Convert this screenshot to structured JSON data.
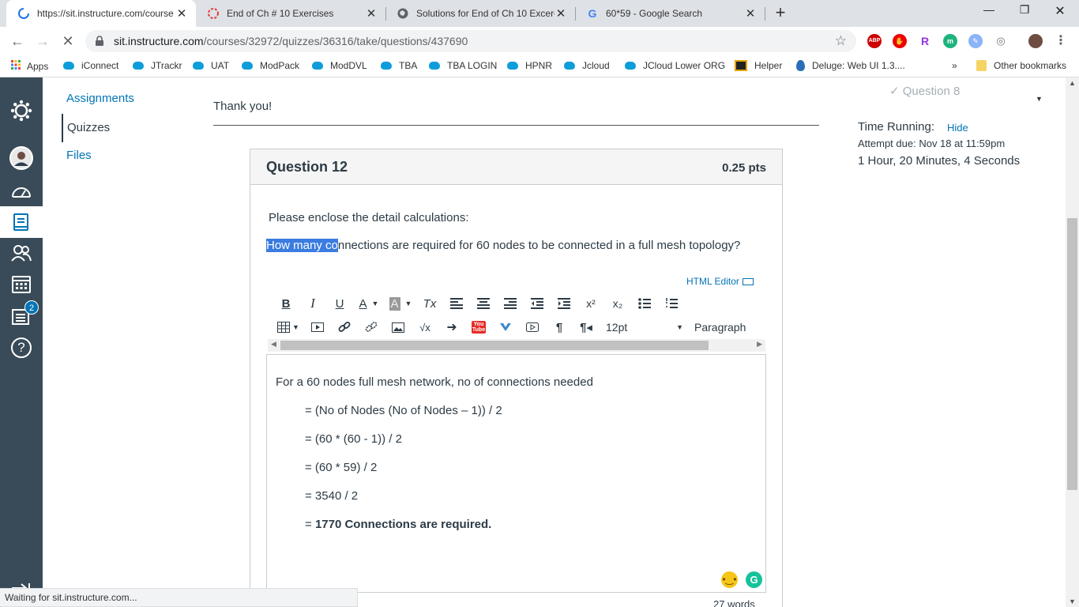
{
  "browser": {
    "tabs": [
      {
        "title": "https://sit.instructure.com/course",
        "active": true
      },
      {
        "title": "End of Ch # 10 Exercises",
        "active": false
      },
      {
        "title": "Solutions for End of Ch 10 Excerc",
        "active": false
      },
      {
        "title": "60*59 - Google Search",
        "active": false
      }
    ],
    "close_glyph": "✕",
    "new_tab_glyph": "+",
    "window_controls": {
      "minimize": "—",
      "restore": "❐",
      "close": "✕"
    },
    "url_host": "sit.instructure.com",
    "url_path": "/courses/32972/quizzes/36316/take/questions/437690",
    "extensions": [
      "ABP",
      "R",
      "m"
    ],
    "bookmarks": [
      "Apps",
      "iConnect",
      "JTrackr",
      "UAT",
      "ModPack",
      "ModDVL",
      "TBA",
      "TBA LOGIN",
      "HPNR",
      "Jcloud",
      "JCloud Lower ORG",
      "Helper",
      "Deluge: Web UI 1.3....",
      "»",
      "Other bookmarks"
    ]
  },
  "global_nav": {
    "badge_count": "2",
    "help_glyph": "?"
  },
  "course_nav": {
    "assignments": "Assignments",
    "quizzes": "Quizzes",
    "files": "Files"
  },
  "quiz": {
    "thank_you": "Thank you!",
    "question_title": "Question 12",
    "points": "0.25 pts",
    "instruction": "Please enclose the detail calculations:",
    "prompt_highlighted": "How many co",
    "prompt_rest": "nnections are required for 60 nodes to be connected in a full mesh topology?",
    "html_editor_link": "HTML Editor",
    "toolbar": {
      "bold": "B",
      "italic": "I",
      "underline": "U",
      "font_color": "A",
      "bg_color": "A",
      "clear_format": "Tx",
      "superscript": "x²",
      "subscript": "x₂",
      "sqrt": "√x",
      "youtube": "You Tube",
      "font_size": "12pt",
      "paragraph": "Paragraph"
    },
    "answer_lines": [
      "For a 60 nodes full mesh network, no of connections needed",
      "= (No of Nodes (No of Nodes – 1)) / 2",
      "= (60 * (60 - 1)) / 2",
      "= (60 * 59) / 2",
      "= 3540 / 2"
    ],
    "answer_final_prefix": "= ",
    "answer_final_bold": "1770 Connections are required.",
    "word_count": "27 words"
  },
  "sidebar": {
    "question8": "Question 8",
    "time_running": "Time Running:",
    "hide": "Hide",
    "attempt_due": "Attempt due: Nov 18 at 11:59pm",
    "timer": "1 Hour, 20 Minutes, 4 Seconds"
  },
  "status_text": "Waiting for sit.instructure.com...",
  "colors": {
    "canvas_nav": "#394b58",
    "link_blue": "#0374b5",
    "selection": "#3a7ce0",
    "text": "#2d3b45"
  }
}
